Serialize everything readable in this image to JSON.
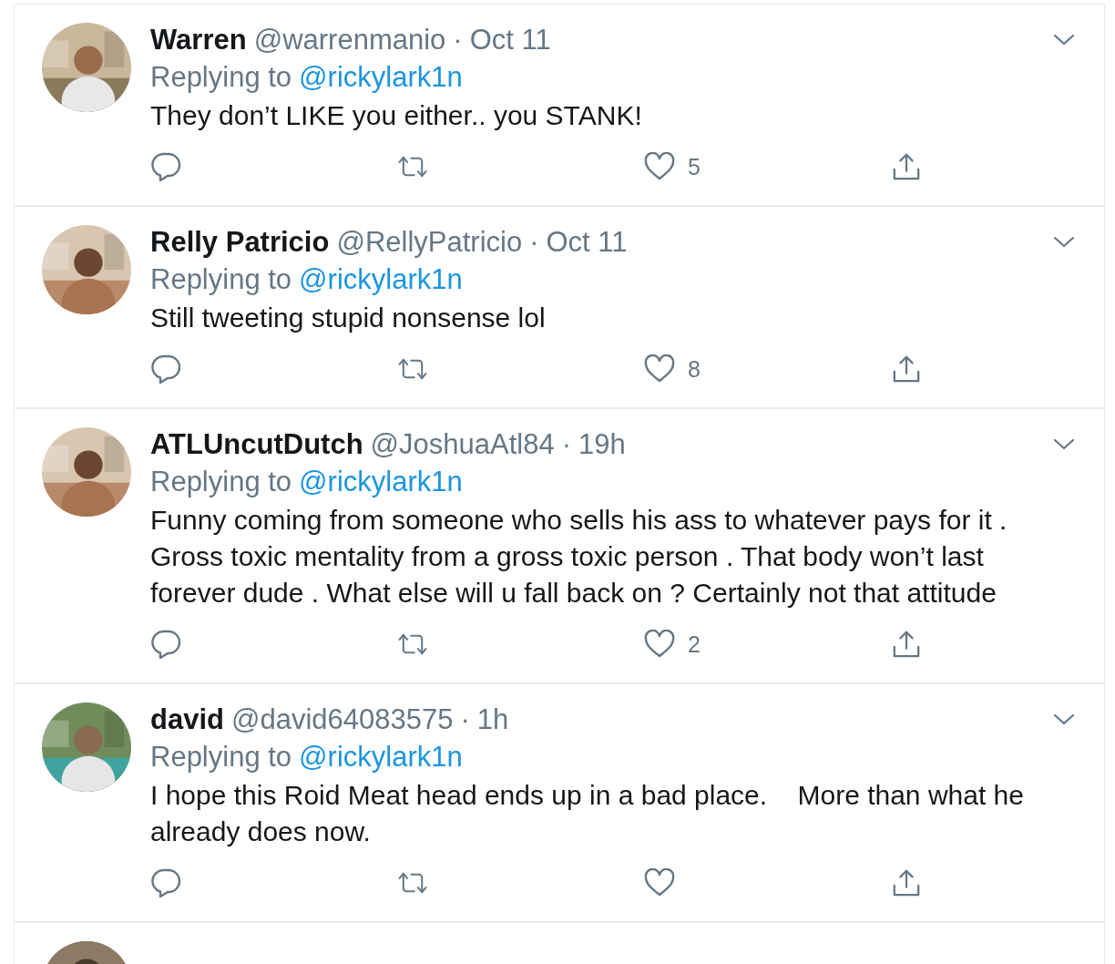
{
  "tweets": [
    {
      "name": "Warren",
      "handle": "@warrenmanio",
      "separator": "·",
      "time": "Oct 11",
      "replying_prefix": "Replying to",
      "mention": "@rickylark1n",
      "text": "They don’t LIKE you either.. you STANK!",
      "likes": "5"
    },
    {
      "name": "Relly Patricio",
      "handle": "@RellyPatricio",
      "separator": "·",
      "time": "Oct 11",
      "replying_prefix": "Replying to",
      "mention": "@rickylark1n",
      "text": "Still tweeting stupid nonsense lol",
      "likes": "8"
    },
    {
      "name": "ATLUncutDutch",
      "handle": "@JoshuaAtl84",
      "separator": "·",
      "time": "19h",
      "replying_prefix": "Replying to",
      "mention": "@rickylark1n",
      "text": "Funny coming from someone who sells his ass to whatever pays for it . Gross toxic mentality from a gross toxic person . That body won’t last forever dude . What else will u fall back on ? Certainly not that attitude",
      "likes": "2"
    },
    {
      "name": "david",
      "handle": "@david64083575",
      "separator": "·",
      "time": "1h",
      "replying_prefix": "Replying to",
      "mention": "@rickylark1n",
      "text": "I hope this Roid Meat head ends up in a bad place.    More than what he already does now."
    }
  ]
}
